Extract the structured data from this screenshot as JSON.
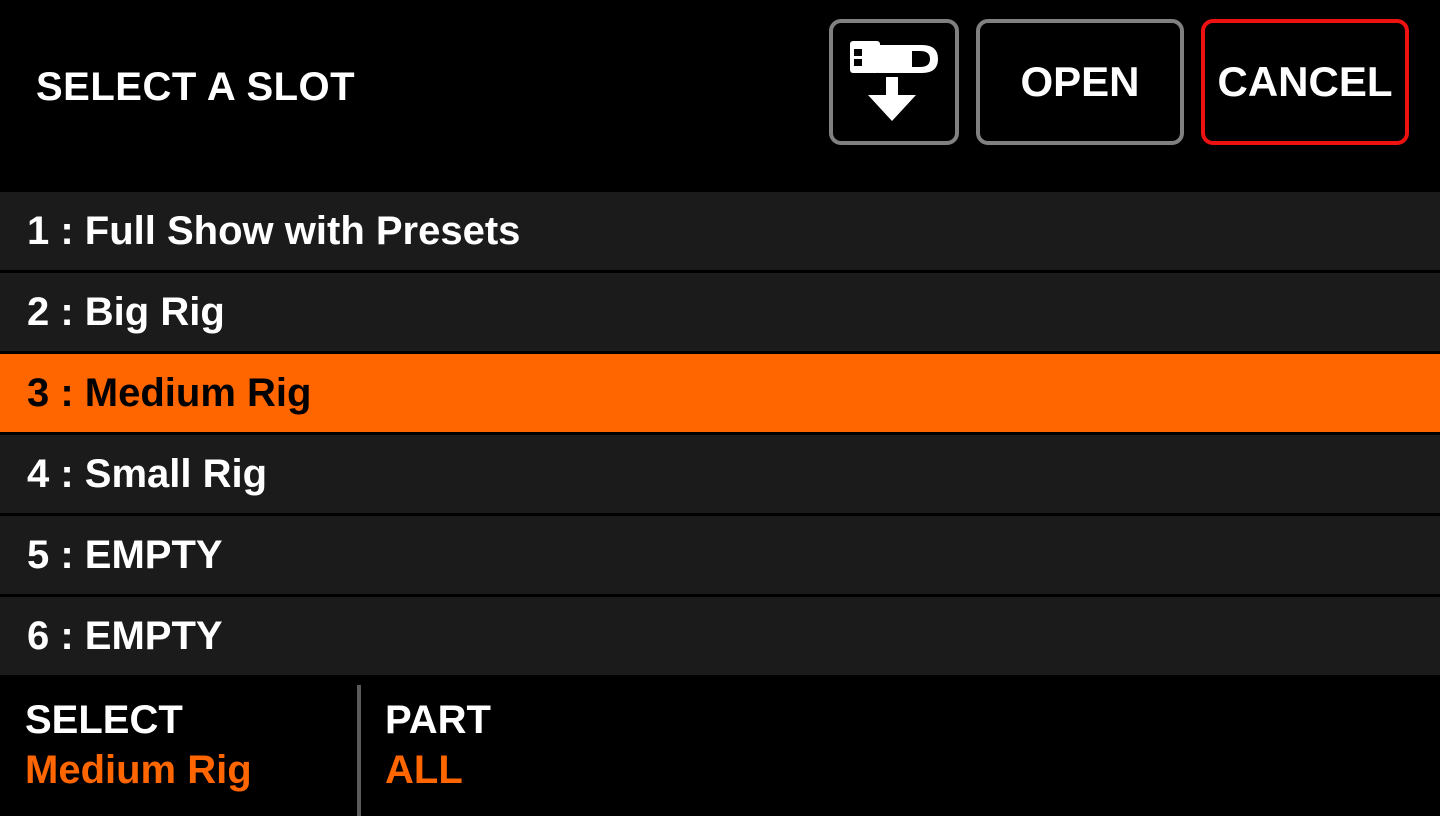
{
  "header": {
    "title": "SELECT A SLOT",
    "usb_button_icon": "usb-load-icon",
    "open_label": "OPEN",
    "cancel_label": "CANCEL"
  },
  "slots": [
    {
      "label": "1 : Full Show with Presets",
      "selected": false
    },
    {
      "label": "2 : Big Rig",
      "selected": false
    },
    {
      "label": "3 : Medium Rig",
      "selected": true
    },
    {
      "label": "4 : Small Rig",
      "selected": false
    },
    {
      "label": "5 : EMPTY",
      "selected": false
    },
    {
      "label": "6 : EMPTY",
      "selected": false
    }
  ],
  "footer": {
    "select_label": "SELECT",
    "select_value": "Medium Rig",
    "part_label": "PART",
    "part_value": "ALL"
  },
  "colors": {
    "accent": "#ff6600",
    "cancel_border": "#ee1111",
    "button_border": "#808080",
    "row_background": "#1b1b1b"
  }
}
